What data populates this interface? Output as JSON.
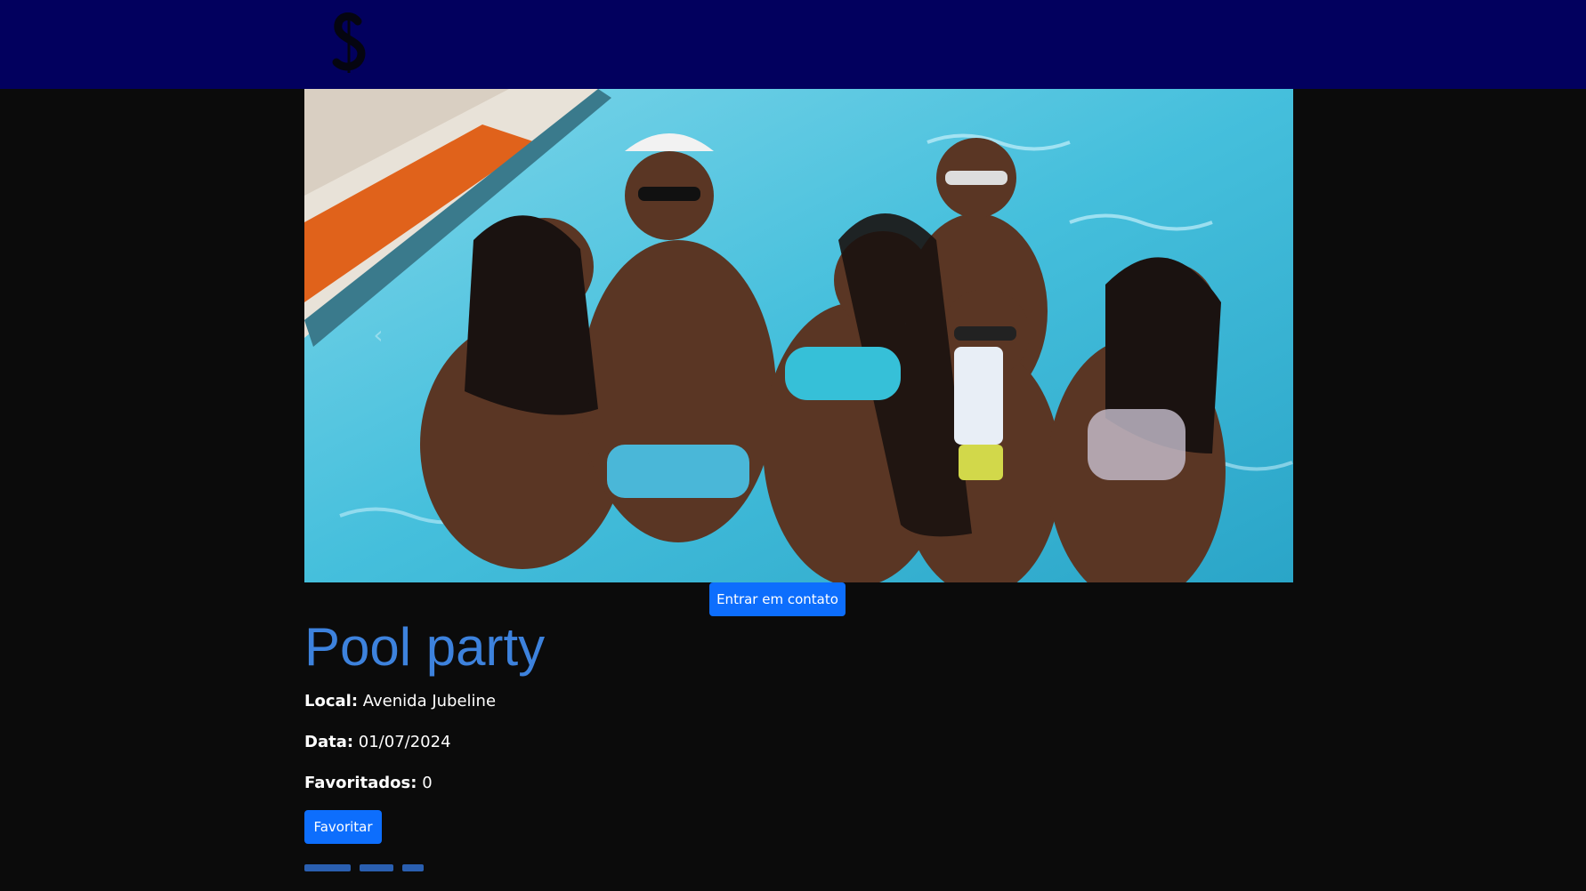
{
  "navbar": {
    "logo_icon": "s-logo-icon",
    "background_color": "#02005e"
  },
  "event": {
    "title": "Pool party",
    "local_label": "Local:",
    "local_value": "Avenida Jubeline",
    "date_label": "Data:",
    "date_value": "01/07/2024",
    "favorites_label": "Favoritados:",
    "favorites_value": "0"
  },
  "buttons": {
    "contact_label": "Entrar em contato",
    "favorite_label": "Favoritar",
    "button_color": "#0d6efd"
  },
  "carousel": {
    "prev_icon": "chevron-left-icon"
  },
  "colors": {
    "title": "#3d82dd",
    "page_background": "#0b0b0b"
  }
}
